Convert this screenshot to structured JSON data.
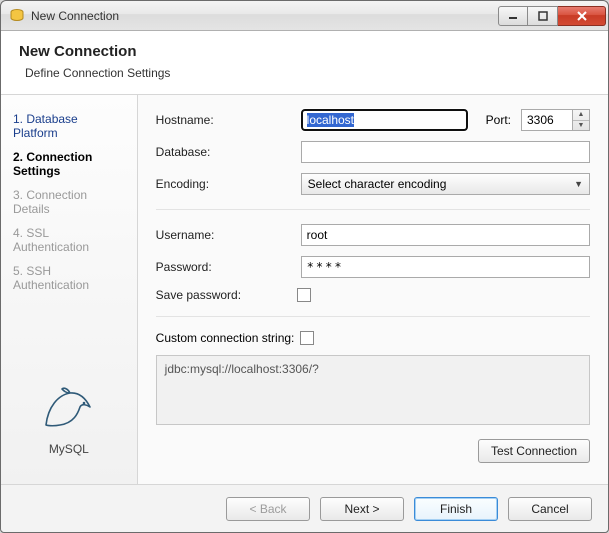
{
  "window": {
    "title": "New Connection"
  },
  "header": {
    "title": "New Connection",
    "subtitle": "Define Connection Settings"
  },
  "sidebar": {
    "steps": [
      {
        "label": "1. Database Platform",
        "state": "enabled"
      },
      {
        "label": "2. Connection Settings",
        "state": "active"
      },
      {
        "label": "3. Connection Details",
        "state": "disabled"
      },
      {
        "label": "4. SSL Authentication",
        "state": "disabled"
      },
      {
        "label": "5. SSH Authentication",
        "state": "disabled"
      }
    ],
    "platform_label": "MySQL"
  },
  "form": {
    "hostname_label": "Hostname:",
    "hostname_value": "localhost",
    "port_label": "Port:",
    "port_value": "3306",
    "database_label": "Database:",
    "database_value": "",
    "encoding_label": "Encoding:",
    "encoding_value": "Select character encoding",
    "username_label": "Username:",
    "username_value": "root",
    "password_label": "Password:",
    "password_value": "****",
    "save_password_label": "Save password:",
    "save_password_checked": false,
    "custom_string_label": "Custom connection string:",
    "custom_string_checked": false,
    "connection_string": "jdbc:mysql://localhost:3306/?",
    "test_button": "Test Connection"
  },
  "footer": {
    "back": "< Back",
    "next": "Next >",
    "finish": "Finish",
    "cancel": "Cancel"
  }
}
